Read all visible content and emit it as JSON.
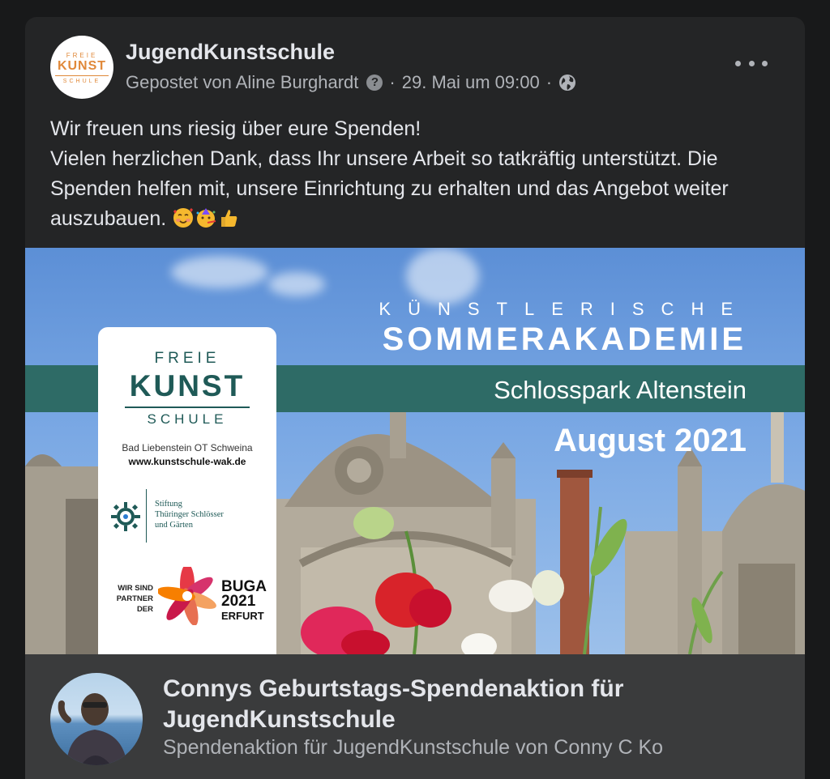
{
  "post": {
    "page_name": "JugendKunstschule",
    "page_logo_text": [
      "FREIE",
      "KUNST",
      "SCHULE"
    ],
    "posted_by": "Gepostet von Aline Burghardt",
    "help_icon": "question-circle-icon",
    "separator": "·",
    "date": "29. Mai um 09:00",
    "audience_icon": "globe-icon",
    "more_icon": "more-horizontal-icon",
    "text": {
      "line1": "Wir freuen uns riesig über eure Spenden!",
      "line2": "Vielen herzlichen Dank, dass Ihr unsere Arbeit so tatkräftig unterstützt. Die Spenden helfen mit, unsere Einrichtung zu erhalten und das Angebot weiter auszubauen.",
      "emojis": [
        "smiling-face-with-hearts-emoji",
        "partying-face-emoji",
        "thumbs-up-emoji"
      ]
    }
  },
  "image": {
    "kicker": "KÜNSTLERISCHE",
    "headline": "SOMMERAKADEMIE",
    "location": "Schlosspark Altenstein",
    "date": "August 2021",
    "logo": {
      "freie": "FREIE",
      "kunst": "KUNST",
      "schule": "SCHULE",
      "address": "Bad Liebenstein OT Schweina",
      "url": "www.kunstschule-wak.de",
      "stiftung": [
        "Stiftung",
        "Thüringer Schlösser",
        "und Gärten"
      ],
      "partner": [
        "WIR SIND",
        "PARTNER",
        "DER"
      ],
      "buga": [
        "BUGA",
        "2021",
        "ERFURT"
      ]
    }
  },
  "fundraiser": {
    "title": "Connys Geburtstags-Spendenaktion für JugendKunstschule",
    "subtitle": "Spendenaktion für JugendKunstschule von Conny C Ko"
  },
  "colors": {
    "background": "#18191a",
    "card": "#242526",
    "footer": "#3a3b3c",
    "text_primary": "#e4e6eb",
    "text_secondary": "#b0b3b8",
    "teal_band": "#2e6b66",
    "logo_orange": "#e0893a"
  }
}
